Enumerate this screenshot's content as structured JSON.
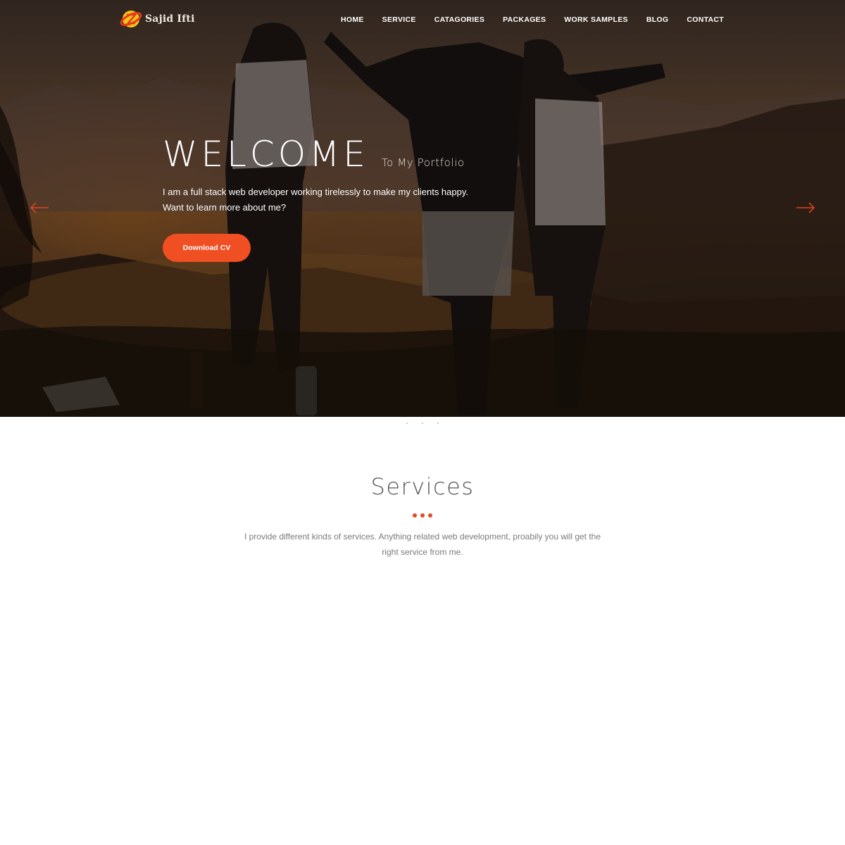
{
  "brand": {
    "name": "Sajid Ifti"
  },
  "nav": {
    "items": [
      {
        "label": "HOME"
      },
      {
        "label": "SERVICE"
      },
      {
        "label": "CATAGORIES"
      },
      {
        "label": "PACKAGES"
      },
      {
        "label": "WORK SAMPLES"
      },
      {
        "label": "BLOG"
      },
      {
        "label": "CONTACT"
      }
    ]
  },
  "hero": {
    "title": "WELCOME",
    "subtitle": "To My Portfolio",
    "intro_line1": "I am a full stack web developer working tirelessly to make my clients happy.",
    "intro_line2": "Want to learn more about me?",
    "cta_label": "Download CV",
    "prev_icon": "arrow-left-icon",
    "next_icon": "arrow-right-icon"
  },
  "services": {
    "title": "Services",
    "description": "I provide different kinds of services. Anything related web development, proabily you will get the right service from me."
  },
  "colors": {
    "accent": "#f04e23",
    "nav_text": "#ffffff",
    "heading_gray": "#555555",
    "body_gray": "#7a7a7a"
  }
}
